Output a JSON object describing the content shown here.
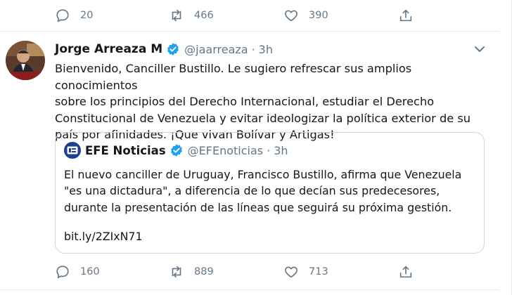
{
  "top_actions": {
    "reply_count": "20",
    "retweet_count": "466",
    "like_count": "390"
  },
  "tweet": {
    "author_name": "Jorge Arreaza M",
    "handle": "@jaarreaza",
    "separator": "·",
    "time": "3h",
    "text": "Bienvenido, Canciller Bustillo. Le sugiero refrescar sus amplios conocimientos\nsobre los principios del Derecho Internacional, estudiar el Derecho\nConstitucional de Venezuela y evitar ideologizar la política exterior de su\npaís por afinidades. ¡Que vivan Bolívar y Artigas!",
    "quoted": {
      "author_name": "EFE Noticias",
      "handle": "@EFEnoticias",
      "separator": "·",
      "time": "3h",
      "text": "El nuevo canciller de Uruguay, Francisco Bustillo, afirma que Venezuela\n\"es una dictadura\", a diferencia de lo que decían sus predecesores,\ndurante la presentación de las líneas que seguirá su próxima gestión.",
      "link": "bit.ly/2ZIxN71"
    },
    "actions": {
      "reply_count": "160",
      "retweet_count": "889",
      "like_count": "713"
    }
  },
  "icons": [
    "reply-icon",
    "retweet-icon",
    "like-icon",
    "share-icon",
    "verified-icon",
    "chevron-down-icon"
  ],
  "colors": {
    "verified": "#1da1f2",
    "secondary_text": "#657786",
    "border": "#ccd6dd"
  }
}
